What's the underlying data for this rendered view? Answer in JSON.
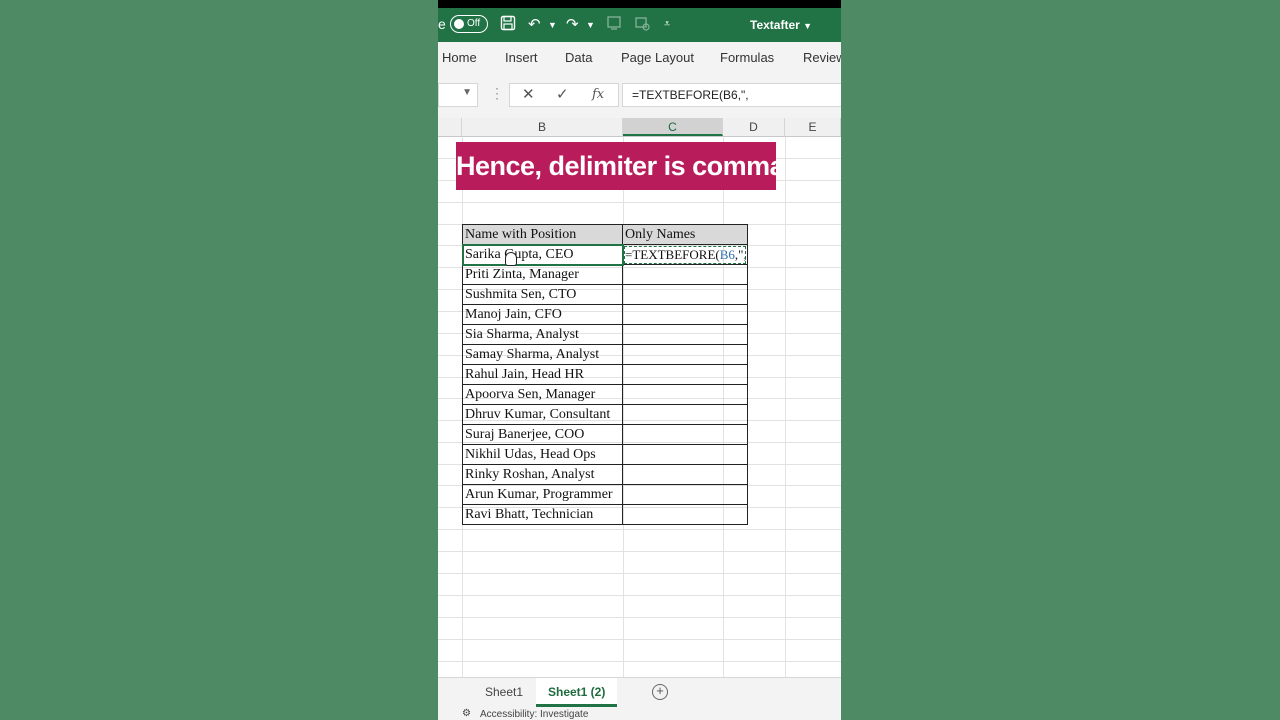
{
  "titlebar": {
    "autosave_partial": "e",
    "toggle_state": "Off",
    "doc_title": "Textafter",
    "icons": [
      "save-icon",
      "undo-icon",
      "redo-icon",
      "form-icon",
      "sync-icon",
      "customize-icon"
    ]
  },
  "ribbon": {
    "tabs": [
      "Home",
      "Insert",
      "Data",
      "Page Layout",
      "Formulas",
      "Review"
    ]
  },
  "formula_bar": {
    "cancel": "✕",
    "enter": "✓",
    "fx": "fx",
    "formula": "=TEXTBEFORE(B6,\","
  },
  "columns": [
    "B",
    "C",
    "D",
    "E"
  ],
  "banner": {
    "text": "Hence, delimiter is comma"
  },
  "table": {
    "headers": [
      "Name with Position",
      "Only Names"
    ],
    "rows": [
      "Sarika Gupta, CEO",
      "Priti Zinta, Manager",
      "Sushmita Sen, CTO",
      "Manoj Jain, CFO",
      "Sia Sharma, Analyst",
      "Samay Sharma, Analyst",
      "Rahul Jain, Head HR",
      "Apoorva Sen, Manager",
      "Dhruv Kumar, Consultant",
      "Suraj Banerjee, COO",
      "Nikhil Udas, Head Ops",
      "Rinky Roshan, Analyst",
      "Arun Kumar, Programmer",
      "Ravi Bhatt, Technician"
    ],
    "edit_prefix": "=TEXTBEFORE(",
    "edit_ref": "B6",
    "edit_suffix": ",\","
  },
  "sheets": {
    "tabs": [
      "Sheet1",
      "Sheet1 (2)"
    ],
    "active_index": 1,
    "add_label": "+"
  },
  "status": {
    "accessibility": "Accessibility: Investigate"
  },
  "colors": {
    "excel_green": "#217346",
    "banner": "#b81c5a",
    "background": "#4e8a63"
  }
}
